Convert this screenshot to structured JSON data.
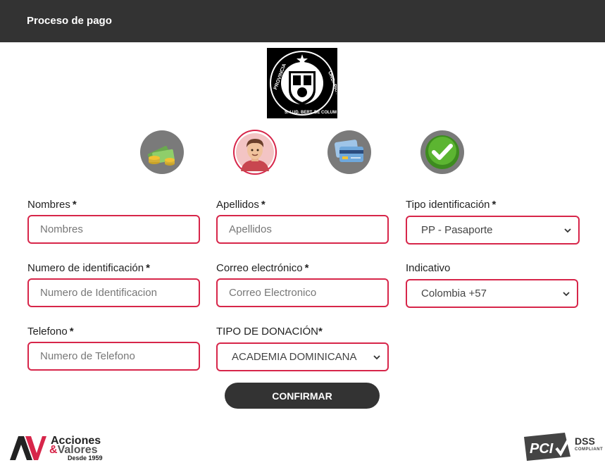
{
  "header": {
    "title": "Proceso de pago"
  },
  "logo": {
    "text_top": "PROVINCIA S. LUD. BERT. DE COLUMBIA",
    "text_right": "ORD. PRAED."
  },
  "steps": [
    {
      "icon": "money-icon"
    },
    {
      "icon": "user-avatar-icon",
      "active": true
    },
    {
      "icon": "credit-card-icon"
    },
    {
      "icon": "checkmark-icon"
    }
  ],
  "form": {
    "required_mark": "*",
    "nombres": {
      "label": "Nombres",
      "placeholder": "Nombres"
    },
    "apellidos": {
      "label": "Apellidos",
      "placeholder": "Apellidos"
    },
    "tipo_identificacion": {
      "label": "Tipo identificación",
      "value": "PP - Pasaporte"
    },
    "numero_identificacion": {
      "label": "Numero de identificación",
      "placeholder": "Numero de Identificacion"
    },
    "correo": {
      "label": "Correo electrónico",
      "placeholder": "Correo Electronico"
    },
    "indicativo": {
      "label": "Indicativo",
      "value": "Colombia +57"
    },
    "telefono": {
      "label": "Telefono",
      "placeholder": "Numero de Telefono"
    },
    "tipo_donacion": {
      "label": "TIPO DE DONACIÓN",
      "required_mark": "*",
      "value": "ACADEMIA DOMINICANA"
    },
    "confirm_label": "CONFIRMAR"
  },
  "footer": {
    "brand_line1": "Acciones",
    "brand_amp": "&",
    "brand_line2": "Valores",
    "brand_line3": "Desde 1959",
    "pci_text": "PCI",
    "dss_text": "DSS",
    "compliant_text": "COMPLIANT"
  },
  "colors": {
    "accent": "#d7264a",
    "header_bg": "#333333",
    "step_bg": "#7a7a7a"
  }
}
